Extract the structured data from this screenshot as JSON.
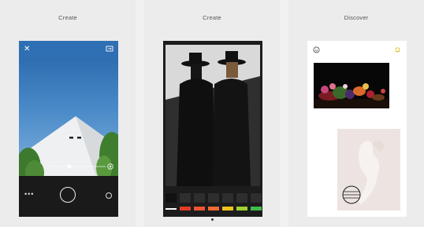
{
  "panels": [
    {
      "title": "Create"
    },
    {
      "title": "Create"
    },
    {
      "title": "Discover"
    }
  ],
  "camera": {
    "close_glyph": "✕",
    "more_glyph": "•••",
    "icons": [
      "close-icon",
      "camera-flip-icon",
      "exposure-target-icon",
      "more-icon",
      "shutter-button",
      "gallery-circle-icon"
    ]
  },
  "editor": {
    "filter_chip_colors": [
      "#e23b25",
      "#ee5533",
      "#ee6a33",
      "#f2c21c",
      "#9fd130",
      "#3fbc49"
    ]
  },
  "discover": {
    "icons": [
      "smiley-icon",
      "bell-icon"
    ],
    "bell_color": "#d6b400"
  }
}
